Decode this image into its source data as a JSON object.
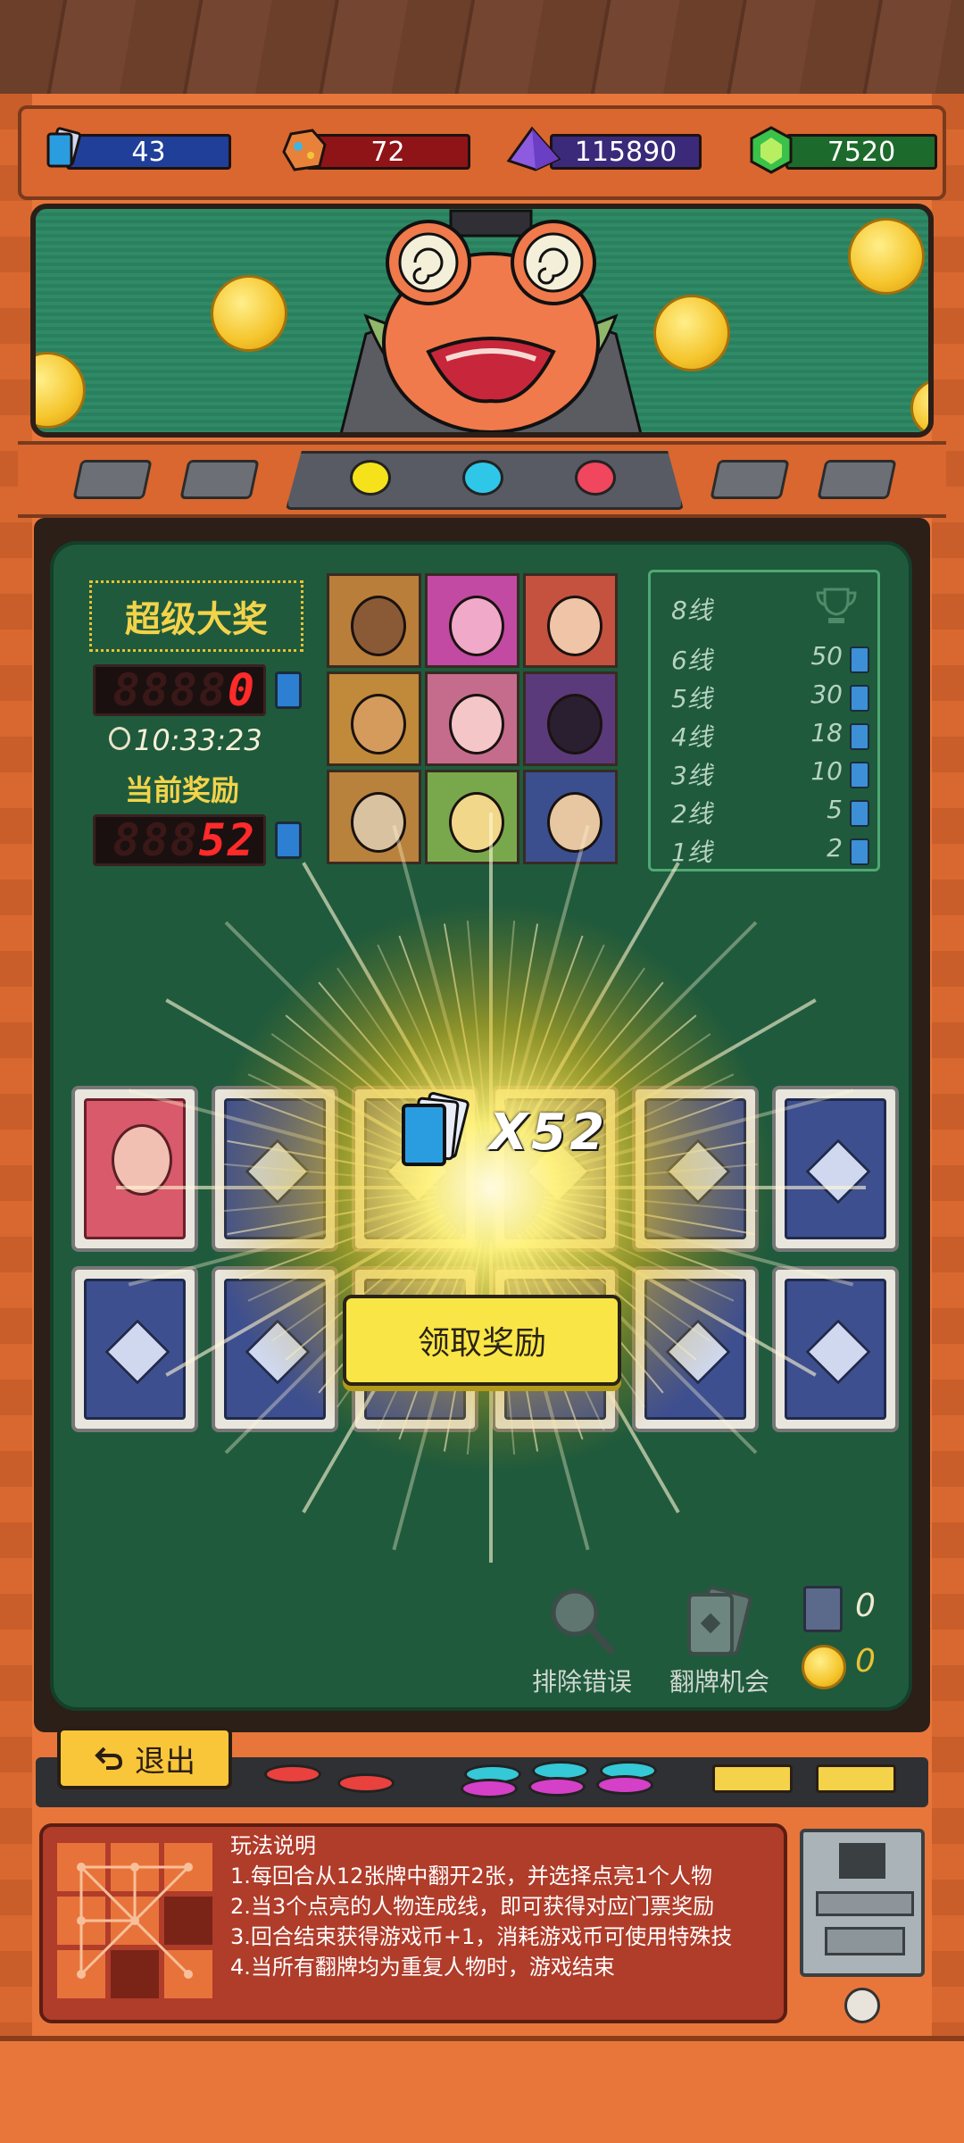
{
  "resources": [
    {
      "name": "tickets",
      "icon": "ticket-stack-icon",
      "value": "43",
      "color": "#1f3f99"
    },
    {
      "name": "ore",
      "icon": "ore-rock-icon",
      "value": "72",
      "color": "#8f1418"
    },
    {
      "name": "crystal",
      "icon": "purple-crystal-icon",
      "value": "115890",
      "color": "#3b2a7a"
    },
    {
      "name": "gem",
      "icon": "green-gem-icon",
      "value": "7520",
      "color": "#1d6b2c"
    }
  ],
  "lamps": [
    "#f6e21b",
    "#2fc7e8",
    "#f0465e"
  ],
  "jackpot": {
    "title": "超级大奖",
    "led_ghost": "8888",
    "value": "0",
    "timer": "10:33:23",
    "current_label": "当前奖励",
    "current_ghost": "888",
    "current_value": "52"
  },
  "portraits": [
    {
      "name": "pirate-hat",
      "bg": "#b97e3a",
      "face": "#8a5a36"
    },
    {
      "name": "pink-hair-girl",
      "bg": "#c24aa3",
      "face": "#f1a9c9"
    },
    {
      "name": "red-hair-antlers",
      "bg": "#c4523e",
      "face": "#f0c4a6"
    },
    {
      "name": "hooded-villain",
      "bg": "#c08a3a",
      "face": "#d49b5c"
    },
    {
      "name": "pink-long-hair",
      "bg": "#c56c8c",
      "face": "#f4c6c8"
    },
    {
      "name": "witch-hat-man",
      "bg": "#5a3a7a",
      "face": "#2a1f30"
    },
    {
      "name": "cowboy-old-man",
      "bg": "#b9823c",
      "face": "#d9c2a0"
    },
    {
      "name": "blonde-man",
      "bg": "#79a84c",
      "face": "#f1d789"
    },
    {
      "name": "wizard-blue",
      "bg": "#3b4f8f",
      "face": "#e7c6a2"
    }
  ],
  "lines": {
    "header": "8线",
    "rows": [
      {
        "label": "6线",
        "value": "50"
      },
      {
        "label": "5线",
        "value": "30"
      },
      {
        "label": "4线",
        "value": "18"
      },
      {
        "label": "3线",
        "value": "10"
      },
      {
        "label": "2线",
        "value": "5"
      },
      {
        "label": "1线",
        "value": "2"
      }
    ]
  },
  "reward": {
    "count": "X52"
  },
  "claim_label": "领取奖励",
  "tools": {
    "eliminate_label": "排除错误",
    "flip_label": "翻牌机会",
    "card_count": "0",
    "coin_count": "0"
  },
  "exit_label": "退出",
  "rules": {
    "title": "玩法说明",
    "items": [
      "1.每回合从12张牌中翻开2张，并选择点亮1个人物",
      "2.当3个点亮的人物连成线，即可获得对应门票奖励",
      "3.回合结束获得游戏币+1，消耗游戏币可使用特殊技",
      "4.当所有翻牌均为重复人物时，游戏结束"
    ]
  }
}
